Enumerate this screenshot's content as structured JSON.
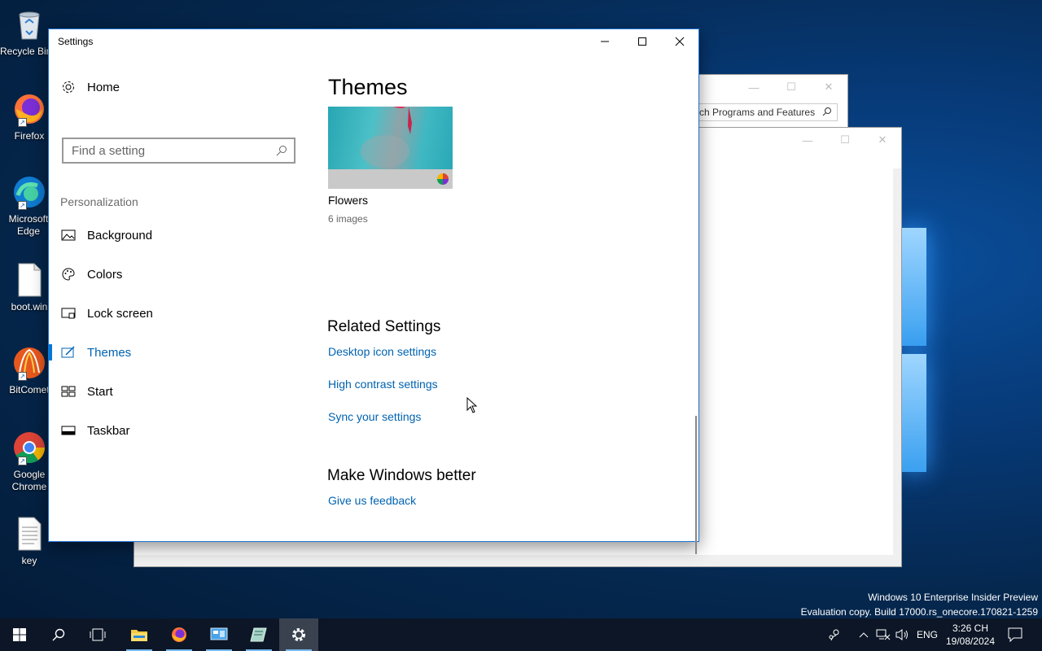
{
  "desktop": {
    "icons": [
      {
        "label": "Recycle Bin",
        "icon": "recycle-bin-icon"
      },
      {
        "label": "Firefox",
        "icon": "firefox-icon"
      },
      {
        "label": "Microsoft Edge",
        "icon": "edge-icon"
      },
      {
        "label": "boot.win",
        "icon": "file-icon"
      },
      {
        "label": "BitComet",
        "icon": "bitcomet-icon"
      },
      {
        "label": "Google Chrome",
        "icon": "chrome-icon"
      },
      {
        "label": "key",
        "icon": "text-file-icon"
      }
    ],
    "watermark": {
      "line1": "Windows 10 Enterprise Insider Preview",
      "line2": "Evaluation copy. Build 17000.rs_onecore.170821-1259"
    }
  },
  "background_window": {
    "search_placeholder": "ch Programs and Features"
  },
  "settings": {
    "window_title": "Settings",
    "nav": {
      "home": "Home",
      "search_placeholder": "Find a setting",
      "section": "Personalization",
      "items": [
        {
          "label": "Background",
          "icon": "picture-icon"
        },
        {
          "label": "Colors",
          "icon": "palette-icon"
        },
        {
          "label": "Lock screen",
          "icon": "lock-screen-icon"
        },
        {
          "label": "Themes",
          "icon": "themes-brush-icon",
          "active": true
        },
        {
          "label": "Start",
          "icon": "start-grid-icon"
        },
        {
          "label": "Taskbar",
          "icon": "taskbar-icon"
        }
      ]
    },
    "content": {
      "title": "Themes",
      "theme": {
        "name": "Flowers",
        "count": "6 images"
      },
      "related_heading": "Related Settings",
      "related_links": [
        "Desktop icon settings",
        "High contrast settings",
        "Sync your settings"
      ],
      "better_heading": "Make Windows better",
      "feedback_link": "Give us feedback"
    }
  },
  "taskbar": {
    "clock_time": "3:26 CH",
    "clock_date": "19/08/2024",
    "language": "ENG"
  },
  "colors": {
    "accent": "#0078d7",
    "link": "#0063b1",
    "taskbar": "#0c1626"
  }
}
